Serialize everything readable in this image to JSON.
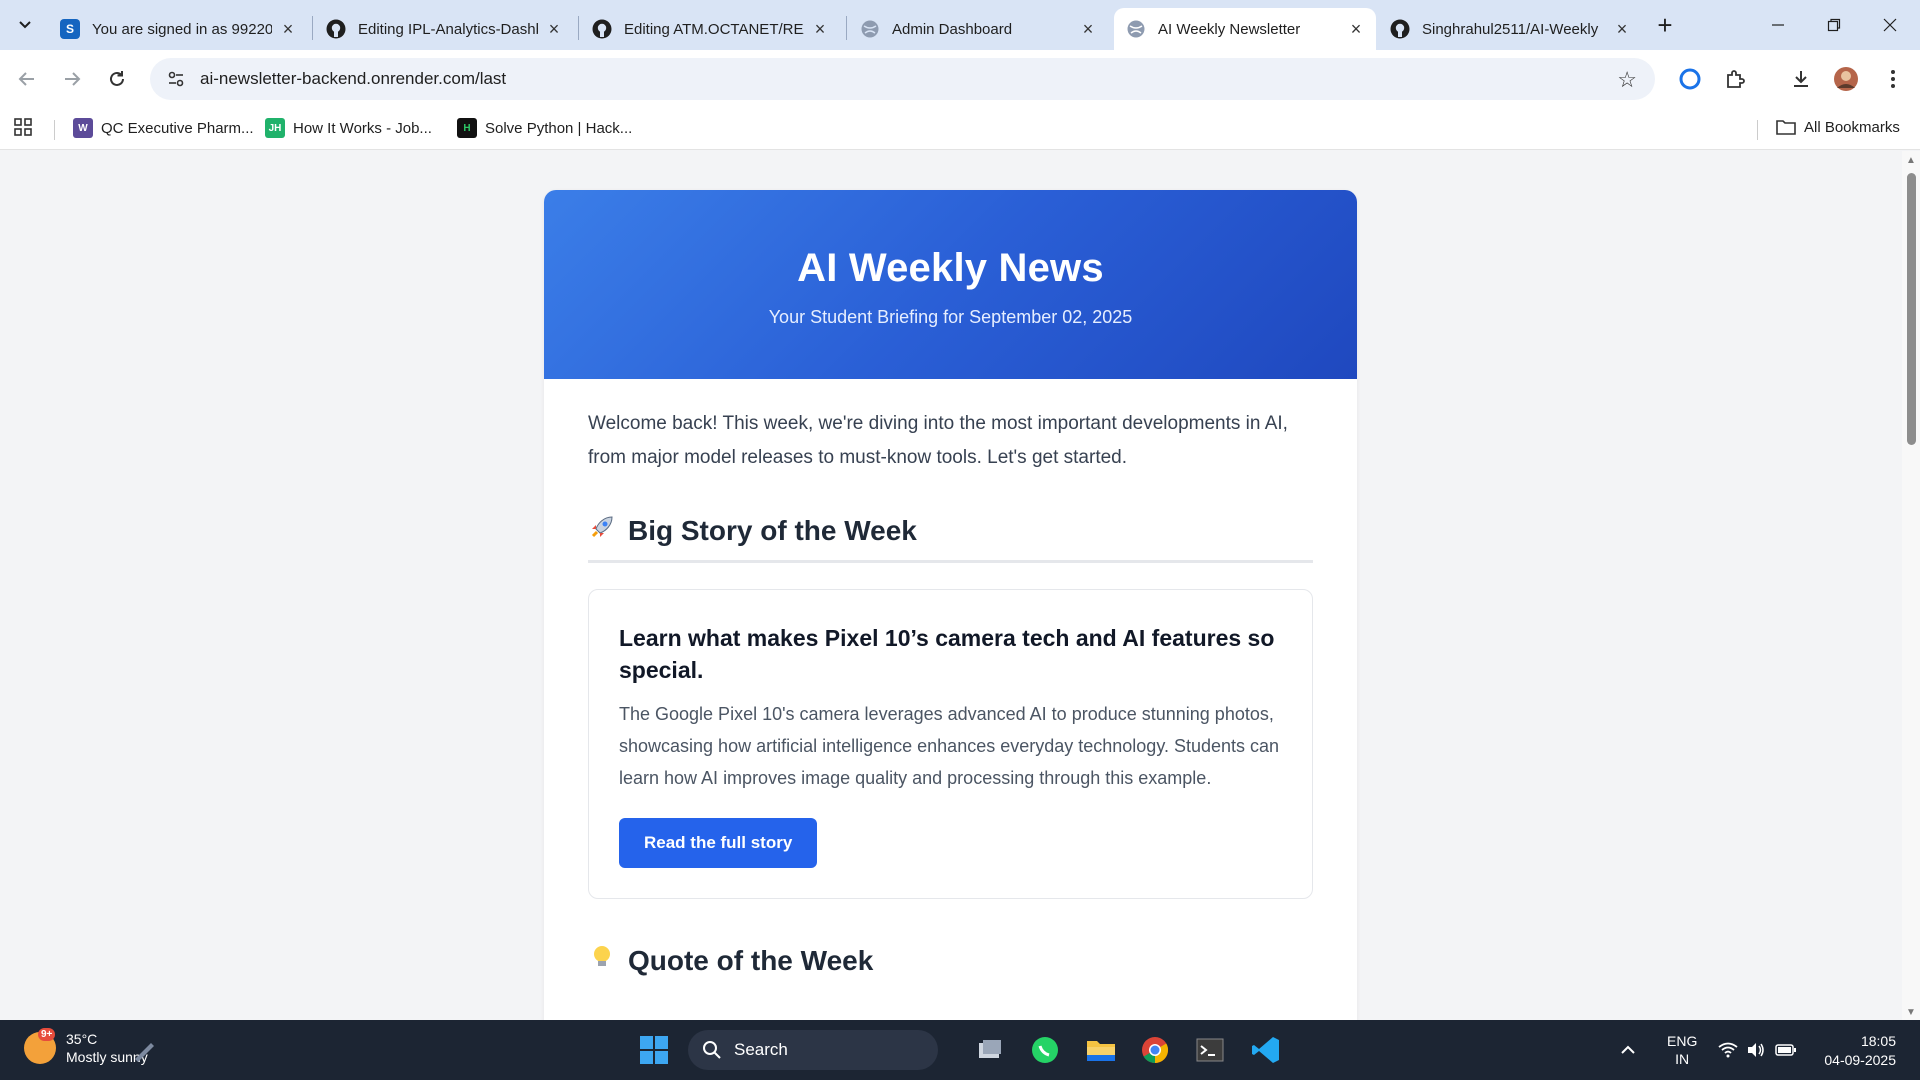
{
  "browser": {
    "tabs": [
      {
        "title": "You are signed in as 99220",
        "active": false
      },
      {
        "title": "Editing IPL-Analytics-Dashb",
        "active": false
      },
      {
        "title": "Editing ATM.OCTANET/REA",
        "active": false
      },
      {
        "title": "Admin Dashboard",
        "active": false
      },
      {
        "title": "AI Weekly Newsletter",
        "active": true
      },
      {
        "title": "Singhrahul2511/AI-Weekly",
        "active": false
      }
    ],
    "url": "ai-newsletter-backend.onrender.com/last",
    "bookmarks": [
      {
        "label": "QC Executive Pharm...",
        "icon_text": "W"
      },
      {
        "label": "How It Works - Job...",
        "icon_text": "JH"
      },
      {
        "label": "Solve Python | Hack...",
        "icon_text": "H"
      }
    ],
    "all_bookmarks_label": "All Bookmarks"
  },
  "newsletter": {
    "title": "AI Weekly News",
    "subtitle": "Your Student Briefing for September 02, 2025",
    "intro": "Welcome back! This week, we're diving into the most important developments in AI, from major model releases to must-know tools. Let's get started.",
    "big_story": {
      "heading": "Big Story of the Week",
      "emoji": "🚀",
      "headline": "Learn what makes Pixel 10’s camera tech and AI features so special.",
      "summary": "The Google Pixel 10's camera leverages advanced AI to produce stunning photos, showcasing how artificial intelligence enhances everyday technology. Students can learn how AI improves image quality and processing through this example.",
      "button": "Read the full story"
    },
    "quote": {
      "heading": "Quote of the Week",
      "emoji": "💡"
    }
  },
  "taskbar": {
    "weather_temp": "35°C",
    "weather_desc": "Mostly sunny",
    "weather_badge": "9+",
    "search_label": "Search",
    "lang_1": "ENG",
    "lang_2": "IN",
    "time": "18:05",
    "date": "04-09-2025"
  },
  "colors": {
    "accent": "#2563eb",
    "hero_start": "#3b7ee8",
    "hero_end": "#1f48bf",
    "taskbar": "#1c2533"
  }
}
